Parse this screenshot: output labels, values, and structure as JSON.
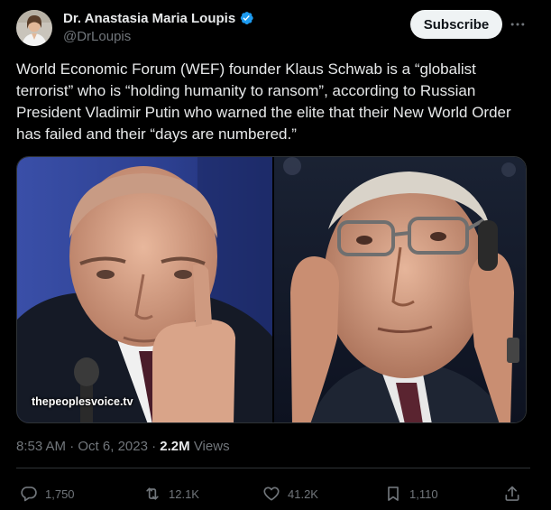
{
  "author": {
    "name": "Dr. Anastasia Maria Loupis",
    "handle": "@DrLoupis"
  },
  "subscribe_label": "Subscribe",
  "tweet_text": "World Economic Forum (WEF) founder Klaus Schwab is a “globalist terrorist” who is “holding humanity to ransom”, according to Russian President Vladimir Putin who warned the elite that their New World Order has failed and their “days are numbered.”",
  "media": {
    "watermark": "thepeoplesvoice.tv"
  },
  "meta": {
    "time": "8:53 AM",
    "separator1": " · ",
    "date": "Oct 6, 2023",
    "separator2": " · ",
    "views_count": "2.2M",
    "views_label": " Views"
  },
  "actions": {
    "replies": "1,750",
    "reposts": "12.1K",
    "likes": "41.2K",
    "bookmarks": "1,110"
  },
  "colors": {
    "background": "#000000",
    "text_primary": "#e7e9ea",
    "text_secondary": "#71767b",
    "verified": "#1d9bf0",
    "divider": "#2f3336",
    "subscribe_bg": "#eff3f4"
  },
  "icons": {
    "verified": "verified-badge-icon",
    "more": "more-horizontal-icon",
    "reply": "reply-icon",
    "repost": "repost-icon",
    "like": "heart-icon",
    "bookmark": "bookmark-icon",
    "share": "share-icon"
  }
}
